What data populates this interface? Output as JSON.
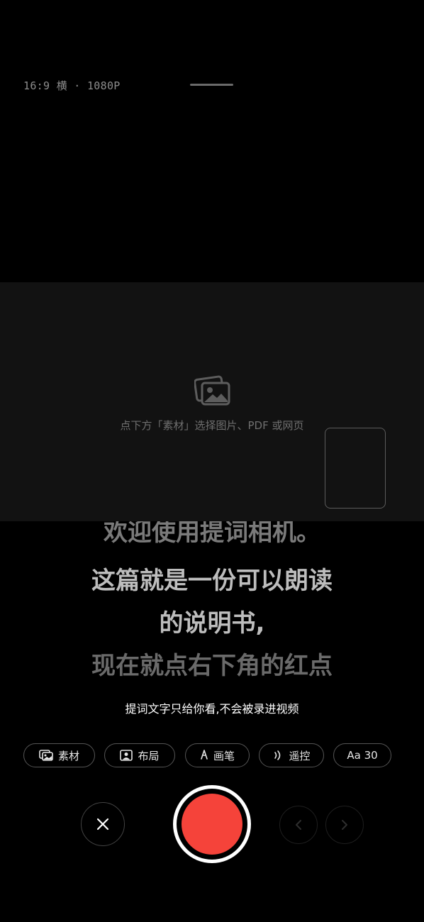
{
  "header": {
    "format": "16:9 横 · 1080P"
  },
  "media_panel": {
    "hint": "点下方「素材」选择图片、PDF 或网页"
  },
  "script": {
    "lines": [
      "欢迎使用提词相机。",
      "这篇就是一份可以朗读",
      "的说明书,",
      "现在就点右下角的红点"
    ]
  },
  "privacy_note": "提词文字只给你看,不会被录进视频",
  "toolbar": {
    "material": "素材",
    "layout": "布局",
    "pen": "画笔",
    "remote": "遥控",
    "font_size": "Aa 30"
  },
  "colors": {
    "record": "#f5433a",
    "background": "#000000",
    "panel": "#121212"
  }
}
